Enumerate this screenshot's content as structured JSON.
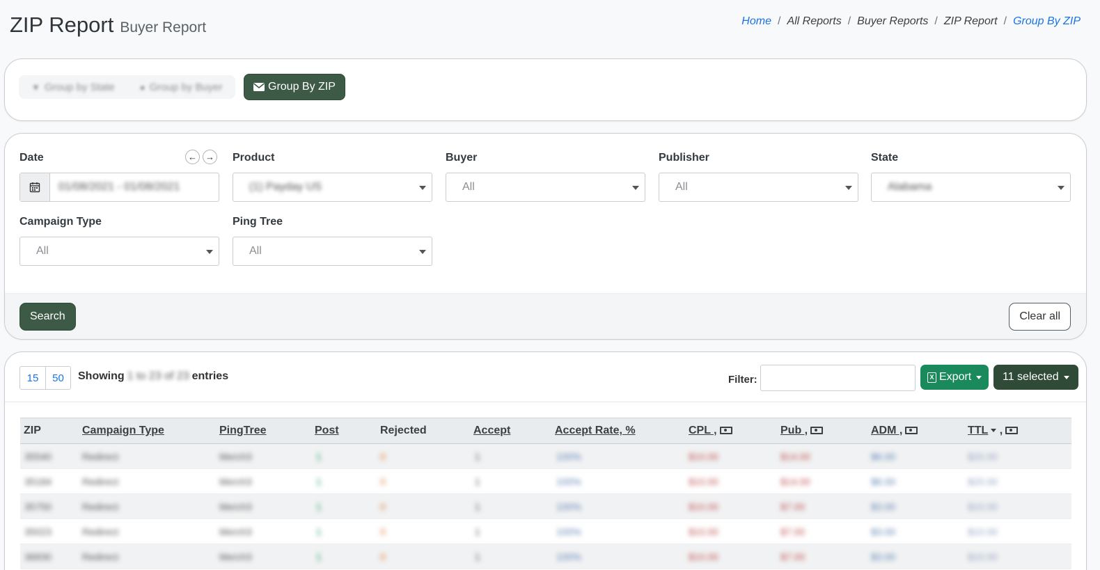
{
  "header": {
    "title": "ZIP Report",
    "subtitle": "Buyer Report",
    "breadcrumb": [
      "Home",
      "All Reports",
      "Buyer Reports",
      "ZIP Report",
      "Group By ZIP"
    ]
  },
  "group_tabs": {
    "items": [
      "Group by State",
      "Group by Buyer"
    ],
    "active": "Group By ZIP"
  },
  "filters": {
    "date": {
      "label": "Date",
      "value": "01/08/2021 - 01/08/2021"
    },
    "product": {
      "label": "Product",
      "value": "(1) Payday US"
    },
    "buyer": {
      "label": "Buyer",
      "value": "All"
    },
    "publisher": {
      "label": "Publisher",
      "value": "All"
    },
    "state": {
      "label": "State",
      "value": "Alabama"
    },
    "campaign_type": {
      "label": "Campaign Type",
      "value": "All"
    },
    "ping_tree": {
      "label": "Ping Tree",
      "value": "All"
    },
    "search_label": "Search",
    "clear_label": "Clear all"
  },
  "table_controls": {
    "page_sizes": [
      "15",
      "50"
    ],
    "showing_prefix": "Showing",
    "showing_range": "1 to 23 of 23",
    "showing_suffix": "entries",
    "filter_label": "Filter:",
    "export_label": "Export",
    "columns_label": "11 selected"
  },
  "table": {
    "columns": [
      "ZIP",
      "Campaign Type",
      "PingTree",
      "Post",
      "Rejected",
      "Accept",
      "Accept Rate, %",
      "CPL ,",
      "Pub ,",
      "ADM ,",
      "TTL"
    ],
    "rows": [
      {
        "zip": "35540",
        "type": "Redirect",
        "tree": "Merch3",
        "post": "1",
        "rejected": "0",
        "accept": "1",
        "rate": "100%",
        "cpl": "$10.00",
        "pub": "$14.00",
        "adm": "$6.00",
        "ttl": "$20.00"
      },
      {
        "zip": "35184",
        "type": "Redirect",
        "tree": "Merch3",
        "post": "1",
        "rejected": "0",
        "accept": "1",
        "rate": "100%",
        "cpl": "$10.00",
        "pub": "$14.00",
        "adm": "$6.00",
        "ttl": "$20.00"
      },
      {
        "zip": "35750",
        "type": "Redirect",
        "tree": "Merch3",
        "post": "1",
        "rejected": "0",
        "accept": "1",
        "rate": "100%",
        "cpl": "$10.00",
        "pub": "$7.00",
        "adm": "$3.00",
        "ttl": "$10.00"
      },
      {
        "zip": "35023",
        "type": "Redirect",
        "tree": "Merch3",
        "post": "1",
        "rejected": "0",
        "accept": "1",
        "rate": "100%",
        "cpl": "$10.00",
        "pub": "$7.00",
        "adm": "$3.00",
        "ttl": "$10.00"
      },
      {
        "zip": "36830",
        "type": "Redirect",
        "tree": "Merch3",
        "post": "1",
        "rejected": "0",
        "accept": "1",
        "rate": "100%",
        "cpl": "$10.00",
        "pub": "$7.00",
        "adm": "$3.00",
        "ttl": "$10.00"
      }
    ]
  }
}
